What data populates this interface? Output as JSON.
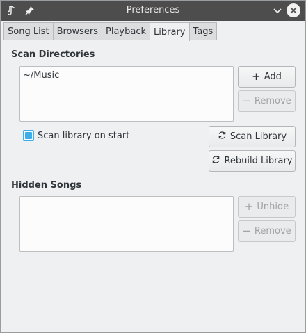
{
  "window": {
    "title": "Preferences",
    "app_icon": "music-note-icon",
    "pin_icon": "pin-icon",
    "minimize_icon": "chevron-down-icon",
    "close_icon": "close-icon"
  },
  "tabs": [
    {
      "label": "Song List",
      "active": false
    },
    {
      "label": "Browsers",
      "active": false
    },
    {
      "label": "Playback",
      "active": false
    },
    {
      "label": "Library",
      "active": true
    },
    {
      "label": "Tags",
      "active": false
    }
  ],
  "scan": {
    "title": "Scan Directories",
    "directories": [
      "~/Music"
    ],
    "add_label": "Add",
    "remove_label": "Remove",
    "scan_on_start_label": "Scan library on start",
    "scan_on_start_checked": true,
    "scan_library_label": "Scan Library",
    "rebuild_library_label": "Rebuild Library"
  },
  "hidden": {
    "title": "Hidden Songs",
    "unhide_label": "Unhide",
    "remove_label": "Remove"
  },
  "colors": {
    "accent": "#3daee9",
    "titlebar": "#4d4d4d",
    "background": "#eff0f1"
  }
}
